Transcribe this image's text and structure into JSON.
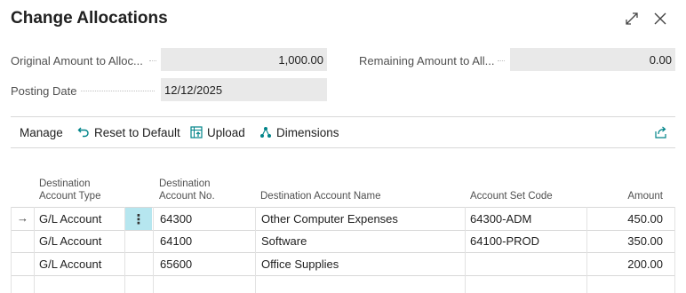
{
  "dialog": {
    "title": "Change Allocations"
  },
  "fields": {
    "original_amount": {
      "label": "Original Amount to Alloc...",
      "value": "1,000.00"
    },
    "remaining_amount": {
      "label": "Remaining Amount to All...",
      "value": "0.00"
    },
    "posting_date": {
      "label": "Posting Date",
      "value": "12/12/2025"
    }
  },
  "actions": {
    "manage": "Manage",
    "reset": "Reset to Default",
    "upload": "Upload",
    "dimensions": "Dimensions"
  },
  "table": {
    "headers": {
      "type_line1": "Destination",
      "type_line2": "Account Type",
      "no_line1": "Destination",
      "no_line2": "Account No.",
      "name": "Destination Account Name",
      "set_code": "Account Set Code",
      "amount": "Amount"
    },
    "rows": [
      {
        "type": "G/L Account",
        "no": "64300",
        "name": "Other Computer Expenses",
        "set_code": "64300-ADM",
        "amount": "450.00"
      },
      {
        "type": "G/L Account",
        "no": "64100",
        "name": "Software",
        "set_code": "64100-PROD",
        "amount": "350.00"
      },
      {
        "type": "G/L Account",
        "no": "65600",
        "name": "Office Supplies",
        "set_code": "",
        "amount": "200.00"
      }
    ]
  },
  "icons": {
    "expand": "expand-icon",
    "close": "close-icon",
    "reset": "undo-icon",
    "upload": "upload-icon",
    "dimensions": "dimensions-icon",
    "share": "share-icon",
    "row_arrow": "row-arrow-icon",
    "row_menu": "vertical-ellipsis-icon"
  },
  "colors": {
    "accent": "#008489",
    "field_bg": "#e9e9e9",
    "selected_cell": "#b6e6ef"
  }
}
